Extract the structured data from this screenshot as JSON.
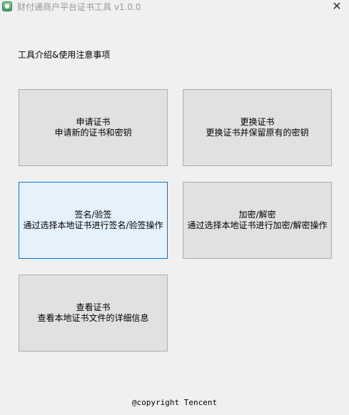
{
  "window": {
    "title": "财付通商户平台证书工具 v1.0.0",
    "close_label": "✕",
    "icon": "shield-app-icon"
  },
  "intro": {
    "label": "工具介绍&使用注意事项"
  },
  "tiles": [
    {
      "title": "申请证书",
      "subtitle": "申请新的证书和密钥"
    },
    {
      "title": "更换证书",
      "subtitle": "更换证书并保留原有的密钥"
    },
    {
      "title": "签名/验签",
      "subtitle": "通过选择本地证书进行签名/验签操作"
    },
    {
      "title": "加密/解密",
      "subtitle": "通过选择本地证书进行加密/解密操作"
    },
    {
      "title": "查看证书",
      "subtitle": "查看本地证书文件的详细信息"
    }
  ],
  "footer": {
    "copyright": "@copyright Tencent"
  },
  "colors": {
    "background": "#f0f0f0",
    "tile": "#e1e1e1",
    "tile_border": "#adadad",
    "tile_hover": "#e5f1fb",
    "tile_hover_border": "#0078d7",
    "title_text": "#999999"
  }
}
